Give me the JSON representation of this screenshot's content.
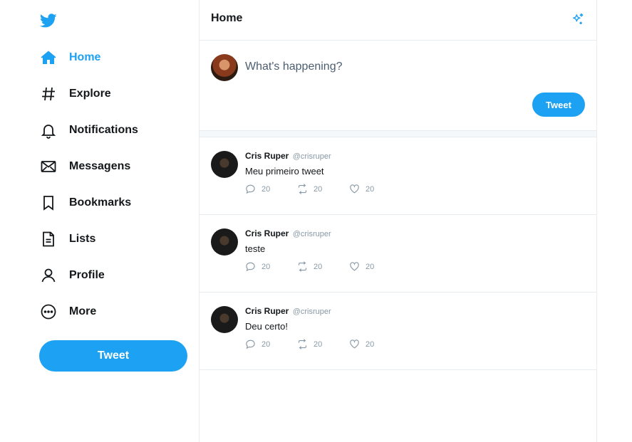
{
  "sidebar": {
    "logo": "twitter-bird-icon",
    "items": [
      {
        "label": "Home",
        "icon": "home-icon",
        "active": true
      },
      {
        "label": "Explore",
        "icon": "hashtag-icon"
      },
      {
        "label": "Notifications",
        "icon": "bell-icon"
      },
      {
        "label": "Messagens",
        "icon": "envelope-icon"
      },
      {
        "label": "Bookmarks",
        "icon": "bookmark-icon"
      },
      {
        "label": "Lists",
        "icon": "list-icon"
      },
      {
        "label": "Profile",
        "icon": "person-icon"
      },
      {
        "label": "More",
        "icon": "more-icon"
      }
    ],
    "tweet_button": "Tweet"
  },
  "main": {
    "header_title": "Home",
    "composer": {
      "placeholder": "What's happening?",
      "tweet_button": "Tweet"
    },
    "tweets": [
      {
        "name": "Cris Ruper",
        "handle": "@crisruper",
        "text": "Meu primeiro tweet",
        "replies": "20",
        "retweets": "20",
        "likes": "20"
      },
      {
        "name": "Cris Ruper",
        "handle": "@crisruper",
        "text": "teste",
        "replies": "20",
        "retweets": "20",
        "likes": "20"
      },
      {
        "name": "Cris Ruper",
        "handle": "@crisruper",
        "text": "Deu certo!",
        "replies": "20",
        "retweets": "20",
        "likes": "20"
      }
    ]
  },
  "colors": {
    "accent": "#1da1f2",
    "text": "#14171a",
    "muted": "#8899a6",
    "border": "#e6ecf0"
  }
}
